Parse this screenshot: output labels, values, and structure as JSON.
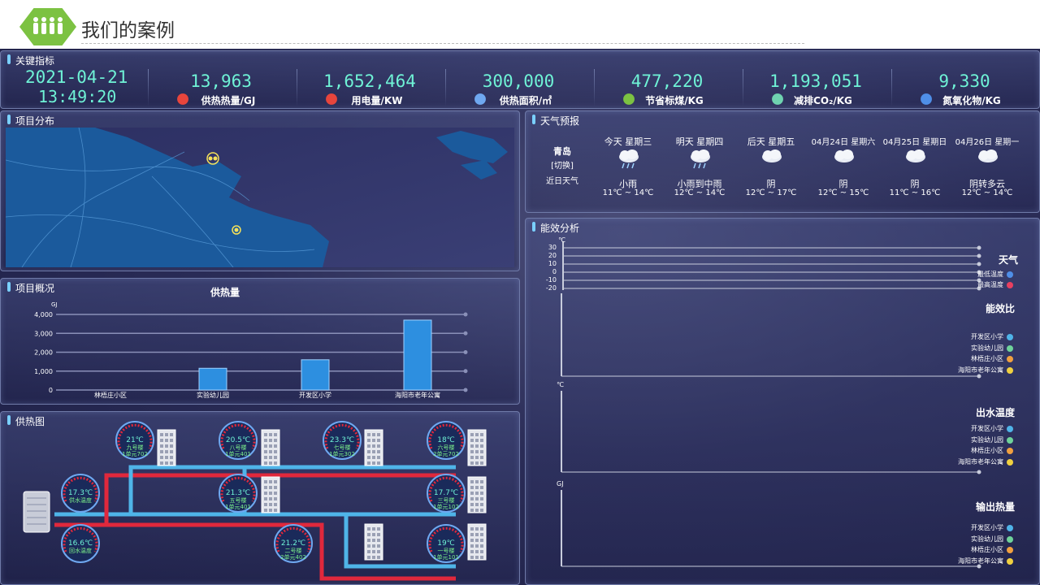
{
  "header": {
    "title": "我们的案例"
  },
  "kpi": {
    "title": "关键指标",
    "date": "2021-04-21",
    "time": "13:49:20",
    "items": [
      {
        "value": "13,963",
        "label": "供热热量/GJ",
        "icon": "fire-icon"
      },
      {
        "value": "1,652,464",
        "label": "用电量/KW",
        "icon": "power-icon"
      },
      {
        "value": "300,000",
        "label": "供热面积/㎡",
        "icon": "house-icon"
      },
      {
        "value": "477,220",
        "label": "节省标煤/KG",
        "icon": "coal-icon"
      },
      {
        "value": "1,193,051",
        "label": "减排CO₂/KG",
        "icon": "co2-icon"
      },
      {
        "value": "9,330",
        "label": "氮氧化物/KG",
        "icon": "nox-icon"
      }
    ]
  },
  "map": {
    "title": "项目分布"
  },
  "overview": {
    "title": "项目概况",
    "chart_title": "供热量"
  },
  "chart_data": {
    "type": "bar",
    "title": "供热量",
    "ylabel": "GJ",
    "categories": [
      "林梧庄小区",
      "实验幼儿园",
      "开发区小学",
      "海阳市老年公寓"
    ],
    "values": [
      0,
      1150,
      1600,
      3700
    ],
    "ylim": [
      0,
      4000
    ],
    "yticks": [
      "0",
      "1,000",
      "2,000",
      "3,000",
      "4,000"
    ]
  },
  "heating": {
    "title": "供热图",
    "gauges": [
      {
        "temp": "21℃",
        "sub1": "九号楼",
        "sub2": "1单元702"
      },
      {
        "temp": "20.5℃",
        "sub1": "八号楼",
        "sub2": "1单元401"
      },
      {
        "temp": "23.3℃",
        "sub1": "七号楼",
        "sub2": "1单元302"
      },
      {
        "temp": "18℃",
        "sub1": "六号楼",
        "sub2": "2单元702"
      },
      {
        "temp": "17.3℃",
        "sub1": "供水温度",
        "sub2": ""
      },
      {
        "temp": "21.3℃",
        "sub1": "五号楼",
        "sub2": "1单元401"
      },
      {
        "temp": "17.7℃",
        "sub1": "三号楼",
        "sub2": "1单元102"
      },
      {
        "temp": "16.6℃",
        "sub1": "回水温度",
        "sub2": ""
      },
      {
        "temp": "21.2℃",
        "sub1": "二号楼",
        "sub2": "2单元402"
      },
      {
        "temp": "19℃",
        "sub1": "一号楼",
        "sub2": "1单元101"
      }
    ]
  },
  "weather": {
    "title": "天气预报",
    "city": "青岛",
    "switch": "[切换]",
    "recent": "近日天气",
    "days": [
      {
        "name": "今天 星期三",
        "cond": "小雨",
        "temp": "11℃ ~ 14℃"
      },
      {
        "name": "明天 星期四",
        "cond": "小雨到中雨",
        "temp": "12℃ ~ 14℃"
      },
      {
        "name": "后天 星期五",
        "cond": "阴",
        "temp": "12℃ ~ 17℃"
      },
      {
        "name": "04月24日 星期六",
        "cond": "阴",
        "temp": "12℃ ~ 15℃"
      },
      {
        "name": "04月25日 星期日",
        "cond": "阴",
        "temp": "11℃ ~ 16℃"
      },
      {
        "name": "04月26日 星期一",
        "cond": "阴转多云",
        "temp": "12℃ ~ 14℃"
      }
    ]
  },
  "efficiency": {
    "title": "能效分析",
    "weather_title": "天气",
    "weather_unit": "℃",
    "weather_ticks": [
      "30",
      "20",
      "10",
      "0",
      "-10",
      "-20"
    ],
    "weather_legend": [
      "最低温度",
      "最高温度"
    ],
    "ratio_title": "能效比",
    "outwater_title": "出水温度",
    "outwater_unit": "℃",
    "heat_title": "输出热量",
    "heat_unit": "GJ",
    "legend_a": [
      "开发区小学",
      "实验幼儿园",
      "林梧庄小区",
      "海阳市老年公寓"
    ],
    "legend_b": [
      "开发区小学",
      "实验幼儿园",
      "林梧庄小区",
      "海阳市老年公寓"
    ],
    "legend_c": [
      "开发区小学",
      "实验幼儿园",
      "林梧庄小区",
      "海阳市老年公寓"
    ],
    "colors": [
      "#4fb4e8",
      "#6fd39a",
      "#f0a040",
      "#f0d040"
    ],
    "weather_colors": [
      "#4f8fe8",
      "#e84060"
    ]
  }
}
